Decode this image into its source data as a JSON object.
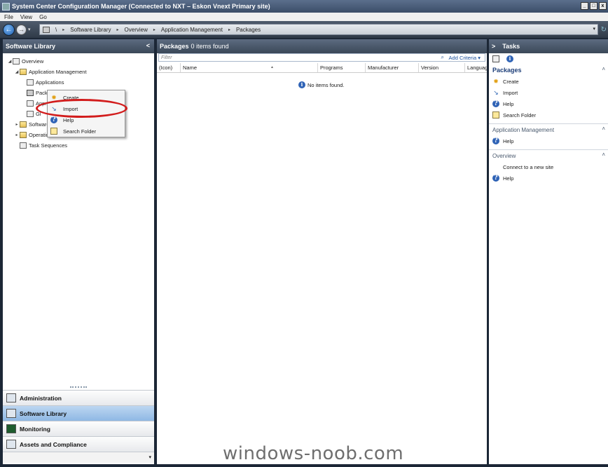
{
  "window": {
    "title": "System Center Configuration Manager (Connected to NXT – Eskon Vnext Primary site)",
    "minimize": "_",
    "maximize": "□",
    "close": "x"
  },
  "menu": [
    "File",
    "View",
    "Go"
  ],
  "nav": {
    "back": "←",
    "forward": "→",
    "dropdown": "▾",
    "breadcrumb": [
      "\\",
      "Software Library",
      "Overview",
      "Application Management",
      "Packages"
    ],
    "separator": "▸",
    "bc_dropdown": "▾",
    "refresh": "↻"
  },
  "left": {
    "title": "Software Library",
    "collapse": "<",
    "tree": [
      {
        "label": "Overview",
        "indent": 0,
        "toggle": "◢",
        "icon": "overview-icon"
      },
      {
        "label": "Application Management",
        "indent": 1,
        "toggle": "◢",
        "icon": "folder-icon"
      },
      {
        "label": "Applications",
        "indent": 2,
        "toggle": "",
        "icon": "applications-icon"
      },
      {
        "label": "Packa",
        "indent": 2,
        "toggle": "",
        "icon": "packages-icon"
      },
      {
        "label": "Appro",
        "indent": 2,
        "toggle": "",
        "icon": "approval-icon"
      },
      {
        "label": "Gl",
        "indent": 2,
        "toggle": "",
        "icon": "global-conditions-icon"
      },
      {
        "label": "Software",
        "indent": 1,
        "toggle": "▸",
        "icon": "folder-icon"
      },
      {
        "label": "Operatin",
        "indent": 1,
        "toggle": "▸",
        "icon": "folder-icon"
      },
      {
        "label": "Task Sequences",
        "indent": 1,
        "toggle": "",
        "icon": "task-sequences-icon"
      }
    ],
    "workspaces": [
      {
        "label": "Administration",
        "active": false,
        "icon": "administration-icon"
      },
      {
        "label": "Software Library",
        "active": true,
        "icon": "software-library-icon"
      },
      {
        "label": "Monitoring",
        "active": false,
        "icon": "monitoring-icon"
      },
      {
        "label": "Assets and Compliance",
        "active": false,
        "icon": "assets-compliance-icon"
      }
    ],
    "footer_chev": "▾"
  },
  "context_menu": [
    {
      "label": "Create",
      "icon": "create-icon",
      "glyph": "✹"
    },
    {
      "label": "Import",
      "icon": "import-icon",
      "glyph": "↘"
    },
    {
      "label": "Help",
      "icon": "help-icon",
      "glyph": "?"
    },
    {
      "label": "Search Folder",
      "icon": "search-folder-icon",
      "glyph": "⌕"
    }
  ],
  "center": {
    "title": "Packages",
    "count": "0 items found",
    "filter_placeholder": "Filter",
    "filter_search": "⌕",
    "criteria": "Add Criteria ▾",
    "sort_glyph": "▲",
    "columns": [
      "(Icon)",
      "Name",
      "Programs",
      "Manufacturer",
      "Version",
      "Language"
    ],
    "info_glyph": "i",
    "empty": "No items found."
  },
  "right": {
    "title": "Tasks",
    "expand": ">",
    "groups": [
      {
        "title": "Packages",
        "primary": true,
        "chev": "˄",
        "tasks": [
          {
            "label": "Create",
            "icon": "create-icon",
            "glyph": "✹",
            "cls": "star"
          },
          {
            "label": "Import",
            "icon": "import-icon",
            "glyph": "↘",
            "cls": "arrow-imp"
          },
          {
            "label": "Help",
            "icon": "help-icon",
            "glyph": "?",
            "cls": "info-dot"
          },
          {
            "label": "Search Folder",
            "icon": "search-folder-icon",
            "glyph": "",
            "cls": "search-fold"
          }
        ]
      },
      {
        "title": "Application Management",
        "primary": false,
        "chev": "˄",
        "tasks": [
          {
            "label": "Help",
            "icon": "help-icon",
            "glyph": "?",
            "cls": "info-dot"
          }
        ]
      },
      {
        "title": "Overview",
        "primary": false,
        "chev": "˄",
        "tasks": [
          {
            "label": "Connect to a new site",
            "icon": "",
            "glyph": "",
            "cls": ""
          },
          {
            "label": "Help",
            "icon": "help-icon",
            "glyph": "?",
            "cls": "info-dot"
          }
        ]
      }
    ]
  },
  "watermark": "windows-noob.com"
}
